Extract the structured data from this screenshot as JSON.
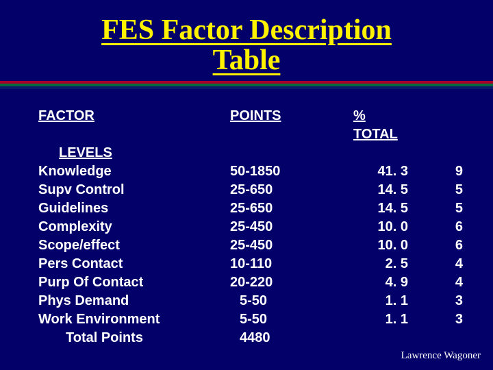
{
  "title_line1": "FES Factor Description",
  "title_line2": "Table",
  "headers": {
    "factor": "FACTOR",
    "points": "POINTS",
    "pct_total": "% TOTAL"
  },
  "subheader": "LEVELS",
  "rows": [
    {
      "factor": "Knowledge",
      "points": "50-1850",
      "pct": "41. 3",
      "levels": "9"
    },
    {
      "factor": "Supv Control",
      "points": "25-650",
      "pct": "14. 5",
      "levels": "5"
    },
    {
      "factor": "Guidelines",
      "points": "25-650",
      "pct": "14. 5",
      "levels": "5"
    },
    {
      "factor": "Complexity",
      "points": "25-450",
      "pct": "10. 0",
      "levels": "6"
    },
    {
      "factor": "Scope/effect",
      "points": "25-450",
      "pct": "10. 0",
      "levels": "6"
    },
    {
      "factor": "Pers Contact",
      "points": "10-110",
      "pct": "2. 5",
      "levels": "4"
    },
    {
      "factor": "Purp Of Contact",
      "points": "20-220",
      "pct": "4. 9",
      "levels": "4"
    },
    {
      "factor": "Phys Demand",
      "points": "5-50",
      "pct": "1. 1",
      "levels": "3",
      "indent_pts": true
    },
    {
      "factor": "Work Environment",
      "points": "5-50",
      "pct": "1. 1",
      "levels": "3",
      "indent_pts": true
    }
  ],
  "total": {
    "label": "Total Points",
    "points": "4480",
    "indent_pts": true
  },
  "footer": "Lawrence Wagoner",
  "chart_data": {
    "type": "table",
    "title": "FES Factor Description Table",
    "columns": [
      "FACTOR",
      "POINTS",
      "% TOTAL",
      "LEVELS"
    ],
    "rows": [
      [
        "Knowledge",
        "50-1850",
        41.3,
        9
      ],
      [
        "Supv Control",
        "25-650",
        14.5,
        5
      ],
      [
        "Guidelines",
        "25-650",
        14.5,
        5
      ],
      [
        "Complexity",
        "25-450",
        10.0,
        6
      ],
      [
        "Scope/effect",
        "25-450",
        10.0,
        6
      ],
      [
        "Pers Contact",
        "10-110",
        2.5,
        4
      ],
      [
        "Purp Of Contact",
        "20-220",
        4.9,
        4
      ],
      [
        "Phys Demand",
        "5-50",
        1.1,
        3
      ],
      [
        "Work Environment",
        "5-50",
        1.1,
        3
      ]
    ],
    "total_points": 4480
  }
}
